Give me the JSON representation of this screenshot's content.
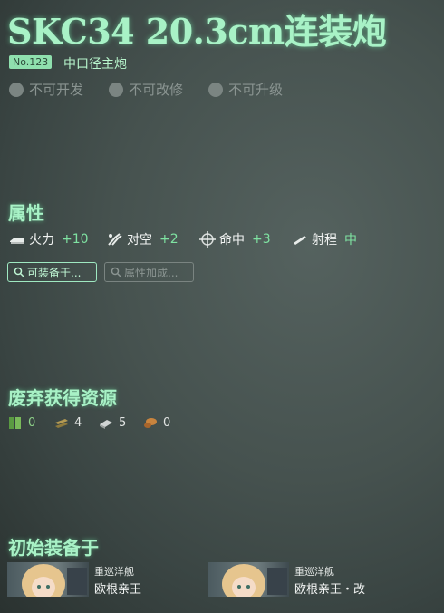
{
  "item": {
    "title": "SKC34 20.3cm连装炮",
    "number": "No.123",
    "type": "中口径主炮",
    "flags": [
      "不可开发",
      "不可改修",
      "不可升级"
    ]
  },
  "attributes": {
    "heading": "属性",
    "stats": [
      {
        "label": "火力",
        "value": "+10",
        "icon": "firepower-icon"
      },
      {
        "label": "对空",
        "value": "+2",
        "icon": "anti-air-icon"
      },
      {
        "label": "命中",
        "value": "+3",
        "icon": "accuracy-icon"
      },
      {
        "label": "射程",
        "value": "中",
        "icon": "range-icon"
      }
    ],
    "buttons": [
      "可装备于...",
      "属性加成..."
    ]
  },
  "scrap": {
    "heading": "废弃获得资源",
    "resources": [
      {
        "name": "fuel-icon",
        "value": "0"
      },
      {
        "name": "ammo-icon",
        "value": "4"
      },
      {
        "name": "steel-icon",
        "value": "5"
      },
      {
        "name": "bauxite-icon",
        "value": "0"
      }
    ]
  },
  "initial": {
    "heading": "初始装备于",
    "ships": [
      {
        "class": "重巡洋舰",
        "name": "欧根亲王"
      },
      {
        "class": "重巡洋舰",
        "name": "欧根亲王・改"
      }
    ]
  }
}
